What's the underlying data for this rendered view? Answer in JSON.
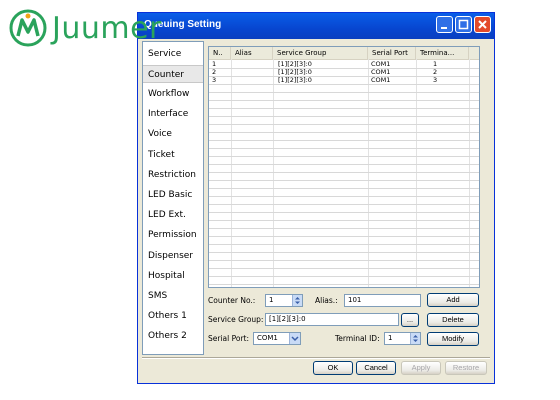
{
  "brand": {
    "logo_text": "Juumer"
  },
  "window": {
    "title": "Queuing Setting"
  },
  "sidebar": {
    "items": [
      {
        "label": "Service"
      },
      {
        "label": "Counter"
      },
      {
        "label": "Workflow"
      },
      {
        "label": "Interface"
      },
      {
        "label": "Voice"
      },
      {
        "label": "Ticket"
      },
      {
        "label": "Restriction"
      },
      {
        "label": "LED Basic"
      },
      {
        "label": "LED Ext."
      },
      {
        "label": "Permission"
      },
      {
        "label": "Dispenser"
      },
      {
        "label": "Hospital"
      },
      {
        "label": "SMS"
      },
      {
        "label": "Others 1"
      },
      {
        "label": "Others 2"
      }
    ],
    "active": "Counter"
  },
  "table": {
    "columns": [
      "N..",
      "Alias",
      "Service Group",
      "Serial Port",
      "Termina..."
    ],
    "rows": [
      [
        "1",
        "",
        "[1][2][3]:0",
        "COM1",
        "1"
      ],
      [
        "2",
        "",
        "[1][2][3]:0",
        "COM1",
        "2"
      ],
      [
        "3",
        "",
        "[1][2][3]:0",
        "COM1",
        "3"
      ]
    ]
  },
  "form": {
    "counter_no_label": "Counter No.:",
    "counter_no_value": "1",
    "alias_label": "Alias.:",
    "alias_value": "101",
    "service_group_label": "Service Group:",
    "service_group_value": "[1][2][3]:0",
    "browse_label": "...",
    "serial_port_label": "Serial Port:",
    "serial_port_value": "COM1",
    "terminal_id_label": "Terminal ID:",
    "terminal_id_value": "1"
  },
  "actions": {
    "add": "Add",
    "delete": "Delete",
    "modify": "Modify"
  },
  "footer": {
    "ok": "OK",
    "cancel": "Cancel",
    "apply": "Apply",
    "restore": "Restore"
  },
  "colors": {
    "titlebar": "#0746d0",
    "close": "#e34a2b",
    "logo": "#2aa35b"
  }
}
